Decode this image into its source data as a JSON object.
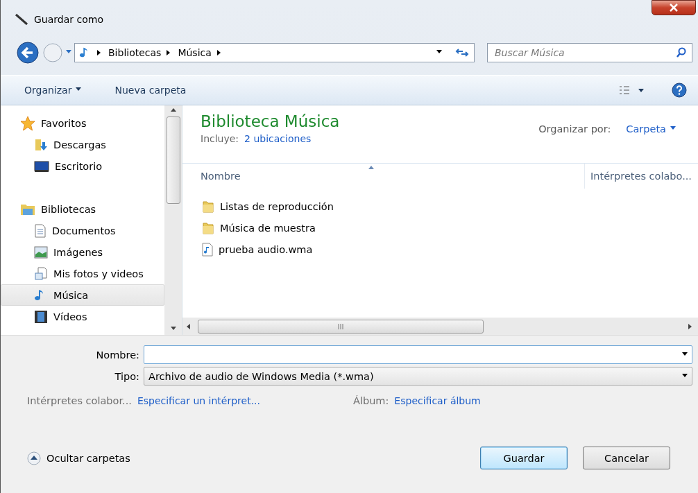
{
  "window": {
    "title": "Guardar como"
  },
  "address": {
    "path": [
      "Bibliotecas",
      "Música"
    ]
  },
  "search": {
    "placeholder": "Buscar Música"
  },
  "toolbar": {
    "organize": "Organizar",
    "new_folder": "Nueva carpeta"
  },
  "sidebar": {
    "groups": [
      {
        "label": "Favoritos",
        "selected": false,
        "children": [
          {
            "label": "Descargas",
            "selected": false
          },
          {
            "label": "Escritorio",
            "selected": false
          }
        ]
      },
      {
        "label": "Bibliotecas",
        "selected": false,
        "children": [
          {
            "label": "Documentos",
            "selected": false
          },
          {
            "label": "Imágenes",
            "selected": false
          },
          {
            "label": "Mis fotos y videos",
            "selected": false
          },
          {
            "label": "Música",
            "selected": true
          },
          {
            "label": "Vídeos",
            "selected": false
          }
        ]
      }
    ]
  },
  "content": {
    "title": "Biblioteca Música",
    "includes_label": "Incluye:",
    "includes_link": "2 ubicaciones",
    "arrange_label": "Organizar por:",
    "arrange_value": "Carpeta",
    "columns": [
      "Nombre",
      "Intérpretes colabo..."
    ],
    "files": [
      {
        "name": "Listas de reproducción",
        "kind": "folder"
      },
      {
        "name": "Música de muestra",
        "kind": "folder"
      },
      {
        "name": "prueba audio.wma",
        "kind": "audio"
      }
    ]
  },
  "form": {
    "name_label": "Nombre:",
    "type_label": "Tipo:",
    "type_value": "Archivo de audio de Windows Media (*.wma)",
    "meta": [
      {
        "label": "Intérpretes colabor...",
        "link": "Especificar un intérpret..."
      },
      {
        "label": "Álbum:",
        "link": "Especificar álbum"
      }
    ]
  },
  "footer": {
    "hide_folders": "Ocultar carpetas",
    "buttons": [
      {
        "label": "Guardar",
        "default": true
      },
      {
        "label": "Cancelar",
        "default": false
      }
    ]
  }
}
